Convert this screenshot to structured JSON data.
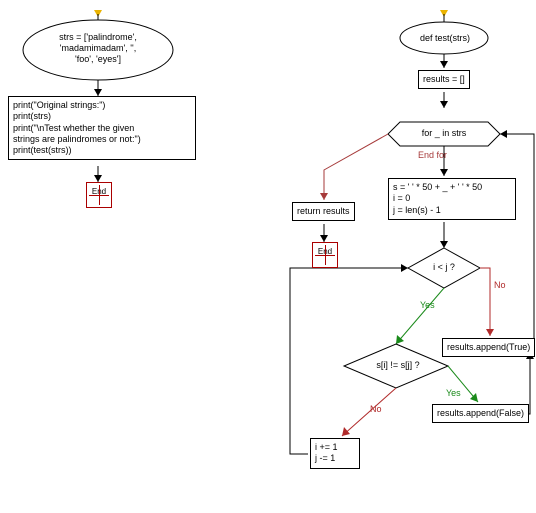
{
  "left": {
    "oval_lines": [
      "strs = ['palindrome',",
      "'madamimadam', '',",
      "'foo', 'eyes']"
    ],
    "box_lines": [
      "print(\"Original strings:\")",
      "print(strs)",
      "print(\"\\nTest whether the given",
      "strings are palindromes or not:\")",
      "print(test(strs))"
    ],
    "end": "End"
  },
  "right": {
    "def": "def test(strs)",
    "init": "results = []",
    "loop": "for _ in strs",
    "endfor": "End for",
    "return": "return results",
    "end": "End",
    "prep_lines": [
      "s = ' ' * 50 + _ + ' ' * 50",
      "i = 0",
      "j = len(s) - 1"
    ],
    "cond1": "i < j ?",
    "cond2": "s[i] != s[j] ?",
    "yes": "Yes",
    "no": "No",
    "appTrue": "results.append(True)",
    "appFalse": "results.append(False)",
    "incdec_lines": [
      "i += 1",
      "j -= 1"
    ]
  }
}
